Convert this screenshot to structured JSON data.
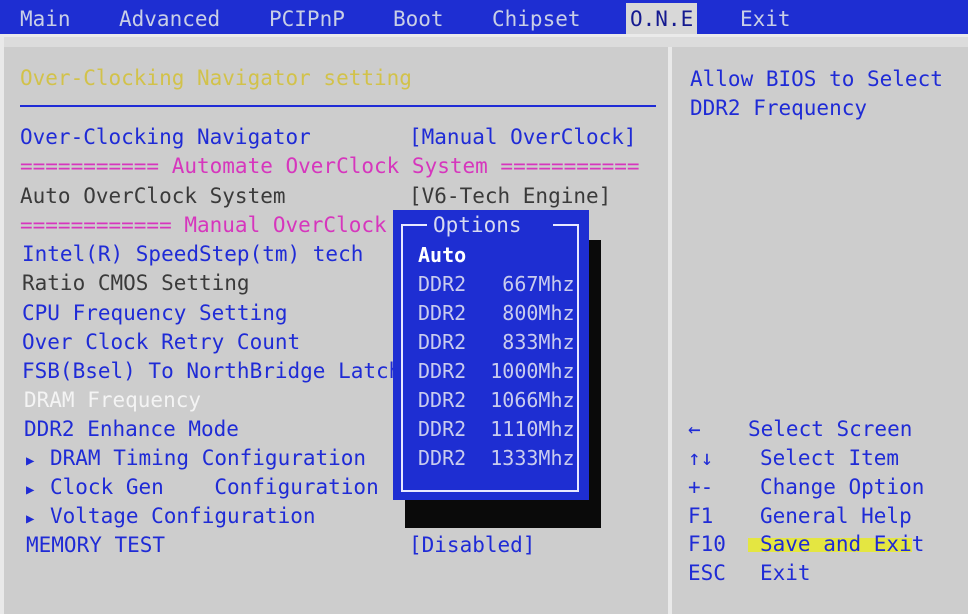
{
  "menu": {
    "tabs": [
      "Main",
      "Advanced",
      "PCIPnP",
      "Boot",
      "Chipset",
      "O.N.E",
      "Exit"
    ],
    "active": "O.N.E"
  },
  "main": {
    "section_title": "Over-Clocking Navigator setting",
    "rows": {
      "navigator_label": "Over-Clocking Navigator",
      "navigator_value": "[Manual OverClock]",
      "auto_sep": "=========== Automate OverClock System ===========",
      "auto_label": "Auto OverClock System",
      "auto_value": "[V6-Tech Engine]",
      "manual_sep": "============ Manual OverClock ============",
      "speedstep": "Intel(R) SpeedStep(tm) tech",
      "ratio": "Ratio CMOS Setting",
      "cpu_freq": "CPU Frequency Setting",
      "retry": "Over Clock Retry Count",
      "fsb": "FSB(Bsel) To NorthBridge Latch",
      "dram_freq": "DRAM Frequency",
      "ddr2_enhance": "DDR2 Enhance Mode",
      "dram_timing": "DRAM Timing Configuration",
      "clock_gen": "Clock Gen    Configuration",
      "voltage": "Voltage Configuration",
      "memtest_label": "MEMORY TEST",
      "memtest_value": "[Disabled]"
    }
  },
  "popup": {
    "title": "Options",
    "options": [
      "Auto",
      "DDR2   667Mhz",
      "DDR2   800Mhz",
      "DDR2   833Mhz",
      "DDR2  1000Mhz",
      "DDR2  1066Mhz",
      "DDR2  1110Mhz",
      "DDR2  1333Mhz"
    ],
    "selected_index": 0
  },
  "help": {
    "description_line1": "Allow BIOS to Select",
    "description_line2": "DDR2 Frequency",
    "keys": [
      {
        "key": "←",
        "action": "Select Screen"
      },
      {
        "key": "↑↓",
        "action": "Select Item"
      },
      {
        "key": "+-",
        "action": "Change Option"
      },
      {
        "key": "F1",
        "action": "General Help"
      },
      {
        "key": "F10",
        "action": "Save and Exit"
      },
      {
        "key": "ESC",
        "action": "Exit"
      }
    ]
  },
  "colors": {
    "bios_blue": "#1e2ed2",
    "panel_gray": "#cdcdcd",
    "title_yellow": "#d2c24a",
    "separator_magenta": "#d636bd",
    "highlight_yellow": "#e8ea28"
  }
}
